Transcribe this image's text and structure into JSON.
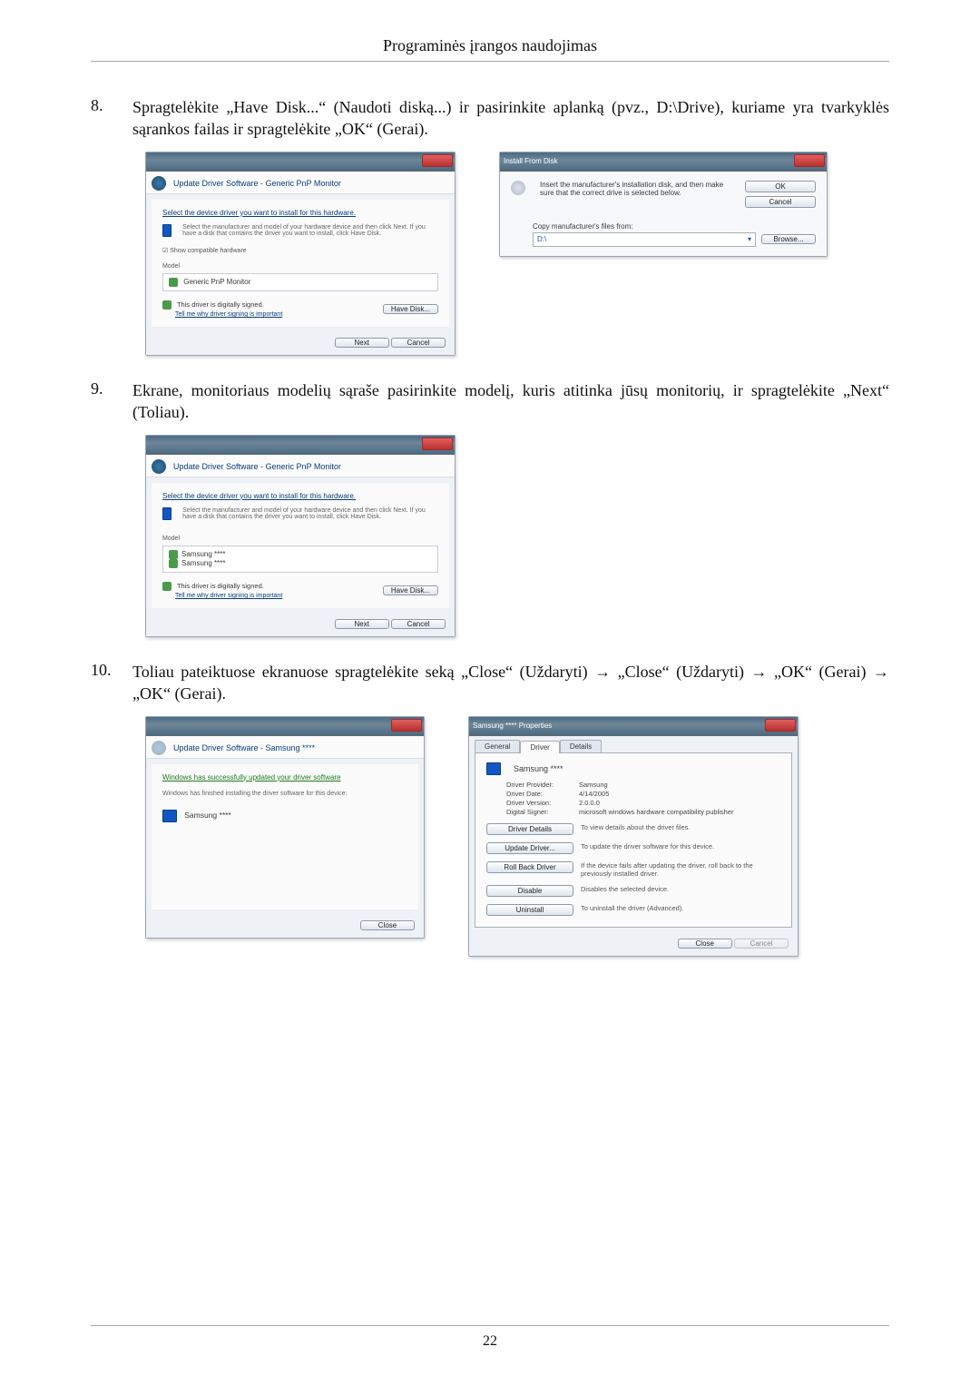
{
  "page": {
    "header": "Programinės įrangos naudojimas",
    "number": "22"
  },
  "steps": {
    "s8": {
      "num": "8.",
      "text": "Spragtelėkite „Have Disk...“ (Naudoti diską...) ir pasirinkite aplanką (pvz., D:\\Drive), kuriame yra tvarkyklės sąrankos failas ir spragtelėkite „OK“ (Gerai)."
    },
    "s9": {
      "num": "9.",
      "text": "Ekrane, monitoriaus modelių sąraše pasirinkite modelį, kuris atitinka jūsų monitorių, ir spragtelėkite „Next“ (Toliau)."
    },
    "s10": {
      "num": "10.",
      "text": "Toliau pateiktuose ekranuose spragtelėkite seką „Close“ (Uždaryti) → „Close“ (Uždaryti) → „OK“ (Gerai) → „OK“ (Gerai)."
    }
  },
  "wiz8": {
    "breadcrumb": "Update Driver Software - Generic PnP Monitor",
    "h1": "Select the device driver you want to install for this hardware.",
    "sub": "Select the manufacturer and model of your hardware device and then click Next. If you have a disk that contains the driver you want to install, click Have Disk.",
    "check": "Show compatible hardware",
    "model_hdr": "Model",
    "model_item": "Generic PnP Monitor",
    "signed": "This driver is digitally signed.",
    "signed_link": "Tell me why driver signing is important",
    "have_disk": "Have Disk...",
    "next": "Next",
    "cancel": "Cancel"
  },
  "ifd": {
    "title": "Install From Disk",
    "msg": "Insert the manufacturer's installation disk, and then make sure that the correct drive is selected below.",
    "ok": "OK",
    "cancel": "Cancel",
    "copy": "Copy manufacturer's files from:",
    "path": "D:\\",
    "browse": "Browse..."
  },
  "wiz9": {
    "breadcrumb": "Update Driver Software - Generic PnP Monitor",
    "h1": "Select the device driver you want to install for this hardware.",
    "sub": "Select the manufacturer and model of your hardware device and then click Next. If you have a disk that contains the driver you want to install, click Have Disk.",
    "model_hdr": "Model",
    "m1": "Samsung ****",
    "m2": "Samsung ****",
    "signed": "This driver is digitally signed.",
    "signed_link": "Tell me why driver signing is important",
    "have_disk": "Have Disk...",
    "next": "Next",
    "cancel": "Cancel"
  },
  "wiz10a": {
    "breadcrumb": "Update Driver Software - Samsung ****",
    "h1": "Windows has successfully updated your driver software",
    "sub": "Windows has finished installing the driver software for this device:",
    "item": "Samsung ****",
    "close": "Close"
  },
  "wiz10b": {
    "title": "Samsung **** Properties",
    "tabs": {
      "general": "General",
      "driver": "Driver",
      "details": "Details"
    },
    "device": "Samsung ****",
    "props": {
      "provider_k": "Driver Provider:",
      "provider_v": "Samsung",
      "date_k": "Driver Date:",
      "date_v": "4/14/2005",
      "ver_k": "Driver Version:",
      "ver_v": "2.0.0.0",
      "signer_k": "Digital Signer:",
      "signer_v": "microsoft windows hardware compatibility publisher"
    },
    "actions": {
      "details": "Driver Details",
      "details_d": "To view details about the driver files.",
      "update": "Update Driver...",
      "update_d": "To update the driver software for this device.",
      "roll": "Roll Back Driver",
      "roll_d": "If the device fails after updating the driver, roll back to the previously installed driver.",
      "disable": "Disable",
      "disable_d": "Disables the selected device.",
      "uninstall": "Uninstall",
      "uninstall_d": "To uninstall the driver (Advanced)."
    },
    "close": "Close",
    "cancel": "Cancel"
  }
}
